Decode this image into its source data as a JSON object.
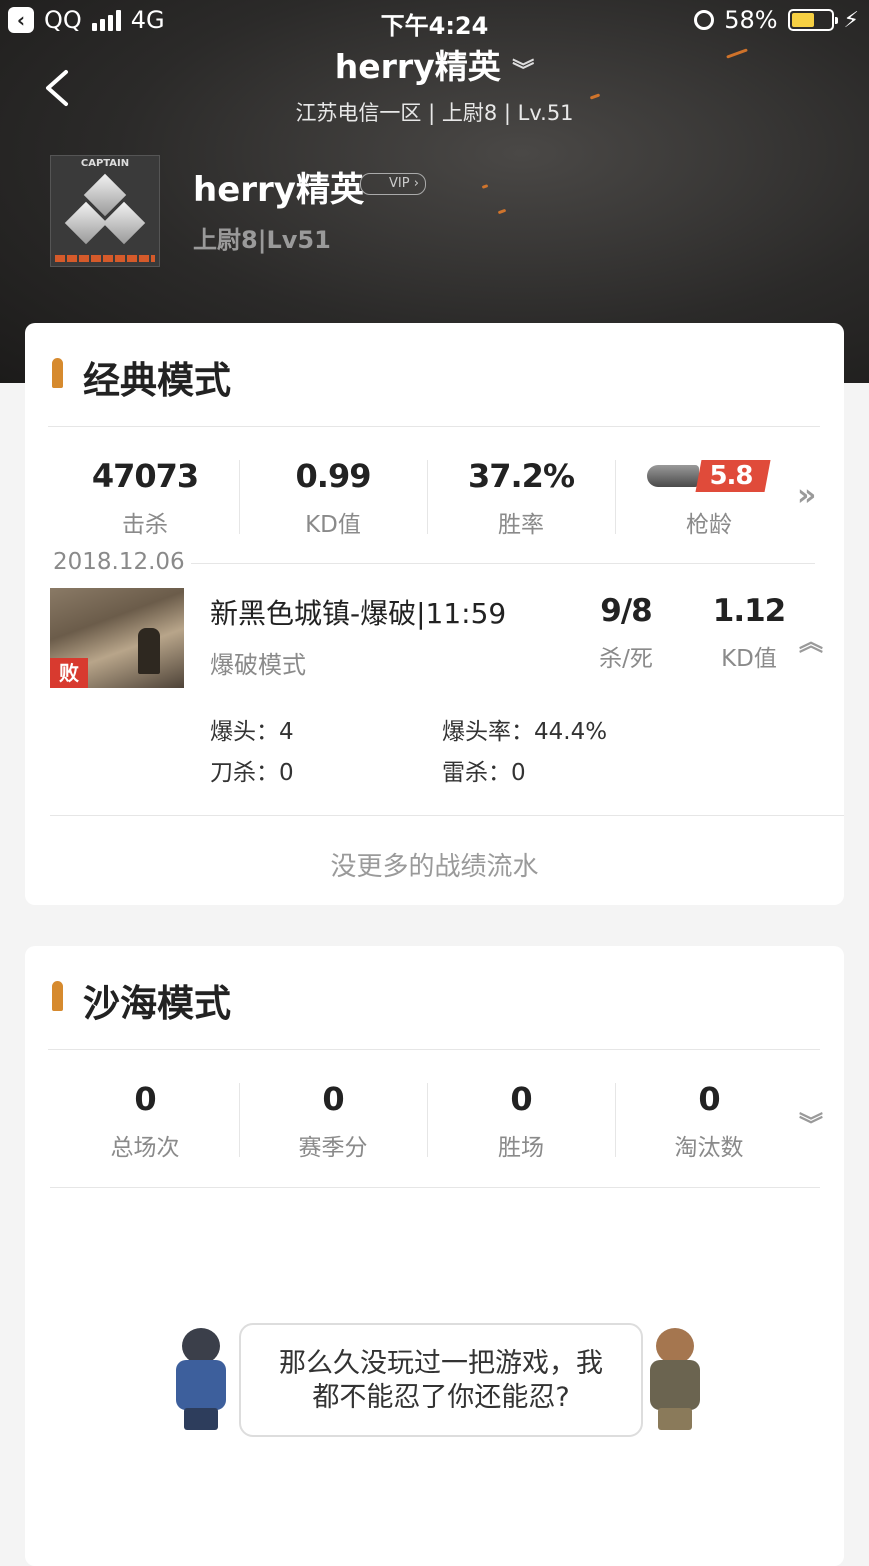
{
  "status_bar": {
    "back_app": "QQ",
    "network": "4G",
    "time": "下午4:24",
    "battery": "58%",
    "battery_level": 0.58
  },
  "nav": {
    "title": "herry精英",
    "subtitle": "江苏电信一区 | 上尉8 | Lv.51"
  },
  "profile": {
    "badge_text": "CAPTAIN",
    "name": "herry精英",
    "vip": "VIP",
    "rank": "上尉8|Lv51"
  },
  "classic": {
    "title": "经典模式",
    "stats": [
      {
        "value": "47073",
        "label": "击杀"
      },
      {
        "value": "0.99",
        "label": "KD值"
      },
      {
        "value": "37.2%",
        "label": "胜率"
      },
      {
        "value": "5.8",
        "label": "枪龄"
      }
    ],
    "more": "»",
    "date": "2018.12.06",
    "match": {
      "result": "败",
      "title": "新黑色城镇-爆破|11:59",
      "mode": "爆破模式",
      "kd_ratio_value": "9/8",
      "kd_ratio_label": "杀/死",
      "kd_value": "1.12",
      "kd_label": "KD值",
      "collapse": "︽",
      "details": [
        {
          "label": "爆头：",
          "value": "4"
        },
        {
          "label": "爆头率：",
          "value": "44.4%"
        },
        {
          "label": "刀杀：",
          "value": "0"
        },
        {
          "label": "雷杀：",
          "value": "0"
        }
      ]
    },
    "no_more": "没更多的战绩流水"
  },
  "desert": {
    "title": "沙海模式",
    "stats": [
      {
        "value": "0",
        "label": "总场次"
      },
      {
        "value": "0",
        "label": "赛季分"
      },
      {
        "value": "0",
        "label": "胜场"
      },
      {
        "value": "0",
        "label": "淘汰数"
      }
    ],
    "expand": "︾",
    "empty_line1": "那么久没玩过一把游戏，我",
    "empty_line2": "都不能忍了你还能忍?"
  },
  "colors": {
    "accent_orange": "#d68a2e",
    "lose_red": "#d83a2f",
    "gun_red": "#e04b3a"
  }
}
